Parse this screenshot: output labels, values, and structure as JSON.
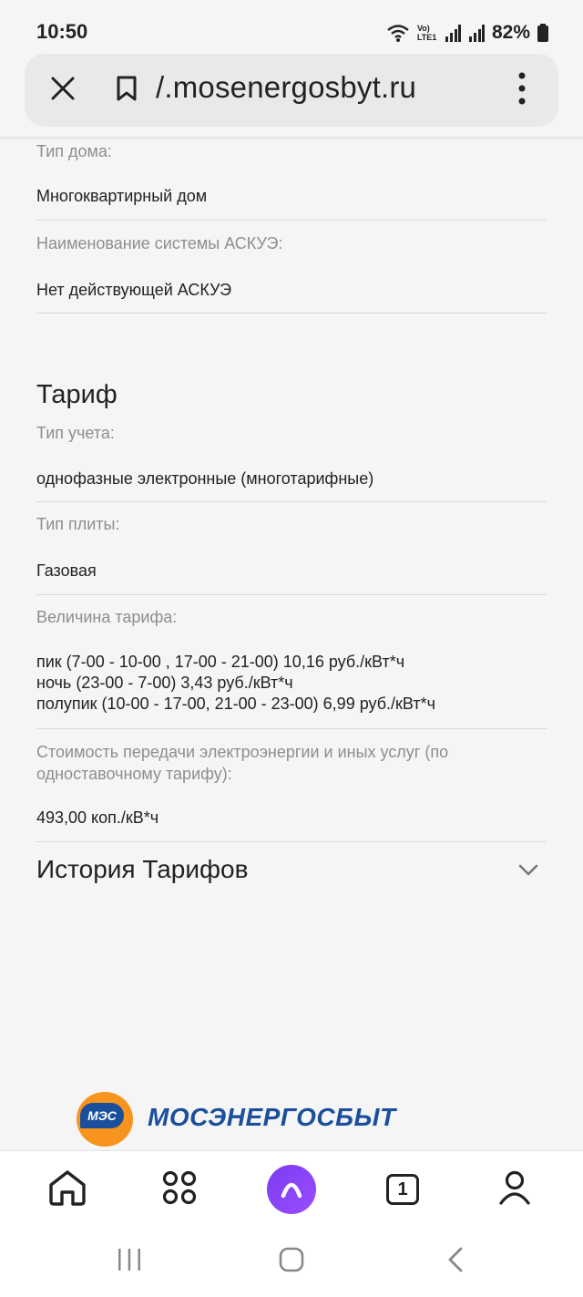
{
  "status_bar": {
    "time": "10:50",
    "network_label": "Vo) LTE1",
    "battery": "82%"
  },
  "address_bar": {
    "url": "/.mosenergosbyt.ru"
  },
  "account_info": {
    "house_type": {
      "label": "Тип дома:",
      "value": "Многоквартирный дом"
    },
    "askue": {
      "label": "Наименование системы АСКУЭ:",
      "value": "Нет действующей АСКУЭ"
    }
  },
  "tariff": {
    "title": "Тариф",
    "metering_type": {
      "label": "Тип учета:",
      "value": "однофазные электронные (многотарифные)"
    },
    "stove_type": {
      "label": "Тип плиты:",
      "value": "Газовая"
    },
    "tariff_value": {
      "label": "Величина тарифа:",
      "lines": [
        "пик (7-00 - 10-00 , 17-00 - 21-00) 10,16 руб./кВт*ч",
        "ночь (23-00 - 7-00) 3,43 руб./кВт*ч",
        "полупик (10-00 - 17-00, 21-00 - 23-00) 6,99 руб./кВт*ч"
      ]
    },
    "transfer_cost": {
      "label": "Стоимость передачи электроэнергии и иных услуг (по одноставочному тарифу):",
      "value": "493,00 коп./кВ*ч"
    }
  },
  "history": {
    "title": "История Тарифов"
  },
  "logo": {
    "badge": "МЭС",
    "text": "МОСЭНЕРГОСБЫТ"
  },
  "toolbar": {
    "tabs_count": "1"
  }
}
